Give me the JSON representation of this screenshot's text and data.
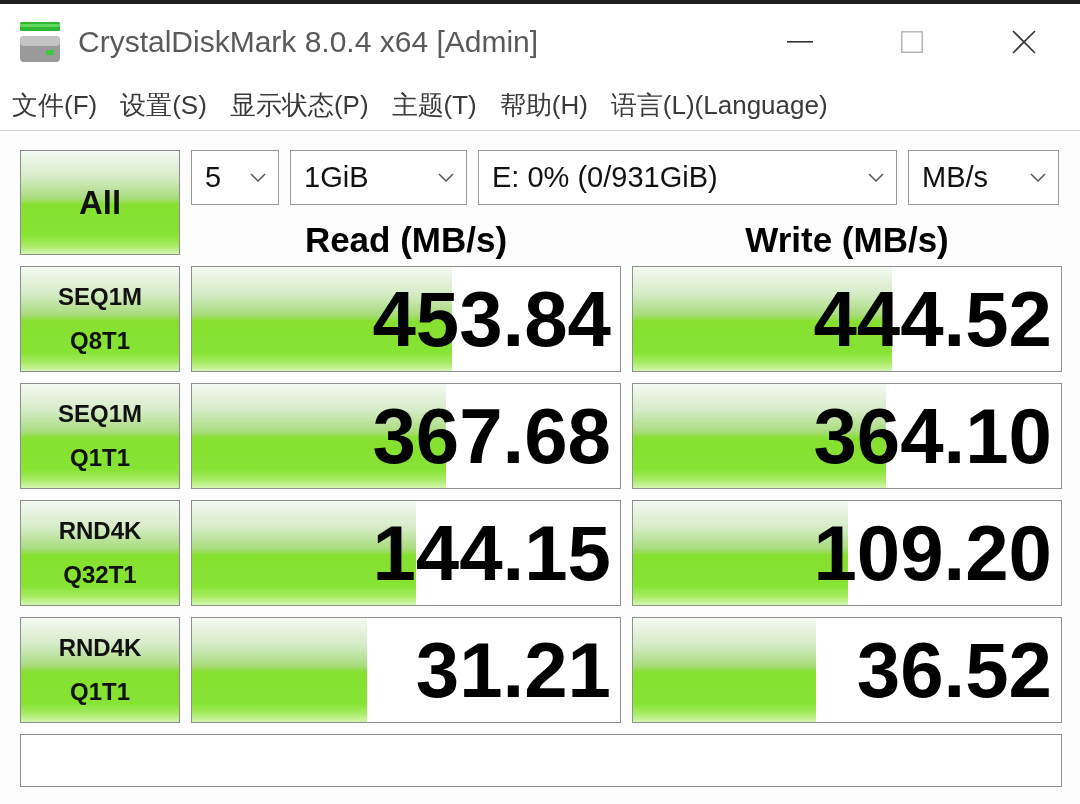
{
  "window": {
    "title": "CrystalDiskMark 8.0.4 x64 [Admin]",
    "maximize_disabled": true
  },
  "menu": [
    "文件(F)",
    "设置(S)",
    "显示状态(P)",
    "主题(T)",
    "帮助(H)",
    "语言(L)(Language)"
  ],
  "all_button": "All",
  "selectors": [
    {
      "value": "5"
    },
    {
      "value": "1GiB"
    },
    {
      "value": "E: 0% (0/931GiB)"
    },
    {
      "value": "MB/s"
    }
  ],
  "columns": [
    "Read (MB/s)",
    "Write (MB/s)"
  ],
  "tests": [
    {
      "label": [
        "SEQ1M",
        "Q8T1"
      ],
      "read": {
        "value": "453.84",
        "level": 0.607
      },
      "write": {
        "value": "444.52",
        "level": 0.606
      }
    },
    {
      "label": [
        "SEQ1M",
        "Q1T1"
      ],
      "read": {
        "value": "367.68",
        "level": 0.593
      },
      "write": {
        "value": "364.10",
        "level": 0.59
      }
    },
    {
      "label": [
        "RND4K",
        "Q32T1"
      ],
      "read": {
        "value": "144.15",
        "level": 0.523
      },
      "write": {
        "value": "109.20",
        "level": 0.503
      }
    },
    {
      "label": [
        "RND4K",
        "Q1T1"
      ],
      "read": {
        "value": "31.21",
        "level": 0.41
      },
      "write": {
        "value": "36.52",
        "level": 0.427
      }
    }
  ]
}
